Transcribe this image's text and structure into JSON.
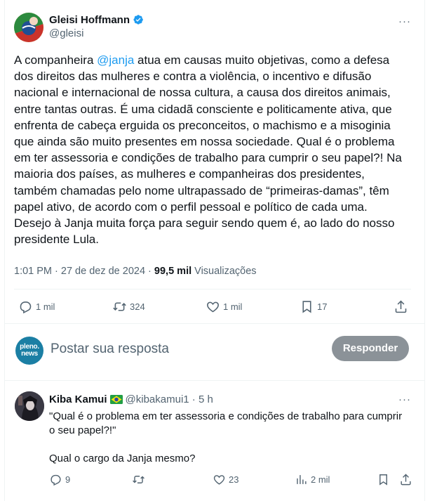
{
  "post": {
    "author_name": "Gleisi Hoffmann",
    "author_handle": "@gleisi",
    "more_label": "···",
    "text_before": "A companheira ",
    "mention": "@janja",
    "text_after": " atua em causas muito objetivas, como a defesa\ndos direitos das mulheres e contra a violência, o incentivo e difusão\nnacional e internacional de nossa cultura, a causa dos direitos animais,\nentre tantas outras. É uma cidadã consciente e politicamente ativa, que\nenfrenta de cabeça erguida os preconceitos, o machismo e a misoginia\nque ainda são muito presentes em nossa sociedade. Qual é o problema\nem ter assessoria e condições de trabalho para cumprir o seu papel?! Na\nmaioria dos países, as mulheres e companheiras dos presidentes,\ntambém chamadas pelo nome ultrapassado de “primeiras-damas”, têm\npapel ativo, de acordo com o perfil pessoal e político de cada uma.\nDesejo à Janja muita força para seguir sendo quem é, ao lado do nosso\npresidente Lula.",
    "time": "1:01 PM",
    "date": "27 de dez de 2024",
    "views_count": "99,5 mil",
    "views_label": "Visualizações",
    "replies": "1 mil",
    "reposts": "324",
    "likes": "1 mil",
    "bookmarks": "17"
  },
  "reply_box": {
    "avatar_text_line1": "pleno.",
    "avatar_text_line2": "news",
    "placeholder": "Postar sua resposta",
    "button_label": "Responder"
  },
  "reply": {
    "author_name": "Kiba Kamui",
    "author_handle": "@kibakamui1",
    "time": "· 5 h",
    "more_label": "···",
    "text": "\"Qual é o problema em ter assessoria e condições de trabalho para cumprir\no seu papel?!\"\n\nQual o cargo da Janja mesmo?",
    "replies": "9",
    "reposts": "",
    "likes": "23",
    "views": "2 mil"
  },
  "colors": {
    "accent": "#1d9bf0",
    "secondary_text": "#536471",
    "button_disabled": "#8b9298",
    "pleno_news": "#1b7fa4"
  }
}
